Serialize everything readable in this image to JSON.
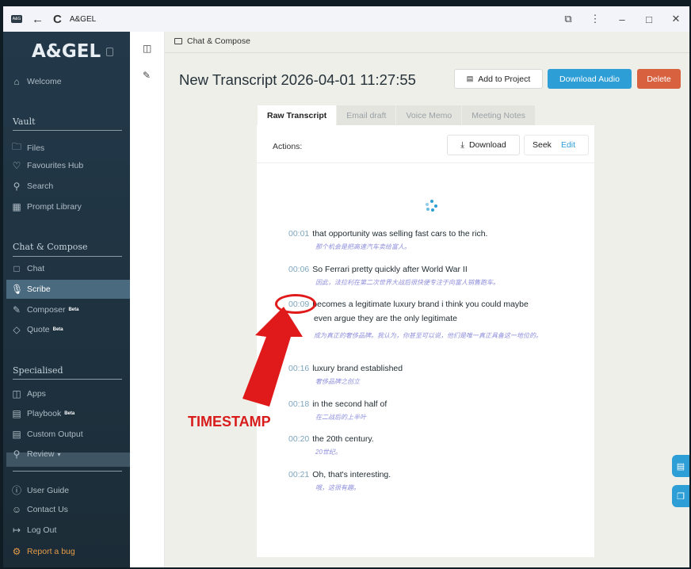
{
  "window": {
    "logo_text": "A&G",
    "title": "A&GEL",
    "back_icon": "back-arrow-icon",
    "reload_icon": "reload-icon"
  },
  "sidebar": {
    "brand": "A&GEL",
    "welcome": "Welcome",
    "sections": {
      "vault": "Vault",
      "chat_compose": "Chat & Compose",
      "specialised": "Specialised"
    },
    "vault_items": [
      {
        "label": "Files",
        "icon": "folder-icon"
      },
      {
        "label": "Favourites Hub",
        "icon": "heart-icon"
      },
      {
        "label": "Search",
        "icon": "search-icon"
      },
      {
        "label": "Prompt Library",
        "icon": "library-icon"
      }
    ],
    "chat_items": [
      {
        "label": "Chat",
        "icon": "chat-icon"
      },
      {
        "label": "Scribe",
        "icon": "microphone-icon",
        "active": true
      },
      {
        "label": "Composer",
        "icon": "pencil-icon",
        "badge": "Beta"
      },
      {
        "label": "Quote",
        "icon": "tag-icon",
        "badge": "Beta"
      }
    ],
    "special_items": [
      {
        "label": "Apps",
        "icon": "apps-icon"
      },
      {
        "label": "Playbook",
        "icon": "book-icon",
        "badge": "Beta"
      },
      {
        "label": "Custom Output",
        "icon": "output-icon"
      },
      {
        "label": "Review",
        "icon": "review-icon"
      }
    ],
    "footer_items": [
      {
        "label": "User Guide",
        "icon": "info-icon"
      },
      {
        "label": "Contact Us",
        "icon": "contacts-icon"
      },
      {
        "label": "Log Out",
        "icon": "logout-icon"
      },
      {
        "label": "Report a bug",
        "icon": "bug-icon"
      }
    ]
  },
  "header": {
    "breadcrumb": "Chat & Compose",
    "title": "New Transcript 2026-04-01 11:27:55",
    "add_to_project": "Add to Project",
    "download_audio": "Download Audio",
    "delete": "Delete"
  },
  "tabs": [
    "Raw Transcript",
    "Email draft",
    "Voice Memo",
    "Meeting Notes"
  ],
  "active_tab": "Raw Transcript",
  "actions": {
    "label": "Actions:",
    "download": "Download",
    "seek": "Seek",
    "edit": "Edit"
  },
  "transcript": [
    {
      "time": "00:01",
      "text": "that opportunity was selling fast cars to the rich.",
      "translation": "那个机会是把高速汽车卖给富人。"
    },
    {
      "time": "00:06",
      "text": "So Ferrari pretty quickly after World War II",
      "translation": "因此，法拉利在第二次世界大战后很快便专注于向富人销售跑车。"
    },
    {
      "time": "00:09",
      "text": "becomes a legitimate luxury brand i think you could maybe",
      "text_cont": "even argue they are the only legitimate",
      "translation": "成为真正的奢侈品牌。我认为，你甚至可以说，他们是唯一真正具备这一地位的。"
    },
    {
      "time": "00:16",
      "text": "luxury brand established",
      "translation": "奢侈品牌之创立"
    },
    {
      "time": "00:18",
      "text": "in the second half of",
      "translation": "在二战后的上半叶"
    },
    {
      "time": "00:20",
      "text": "the 20th century.",
      "translation": "20世纪。"
    },
    {
      "time": "00:21",
      "text": "Oh, that's interesting.",
      "translation": "哦，这很有趣。"
    }
  ],
  "annotation": {
    "label": "TIMESTAMP",
    "color": "#d81c1c"
  },
  "colors": {
    "accent": "#2d9ed6",
    "danger": "#d8623f",
    "sidebar": "#1f3240",
    "active_nav": "#4a6a7f"
  }
}
